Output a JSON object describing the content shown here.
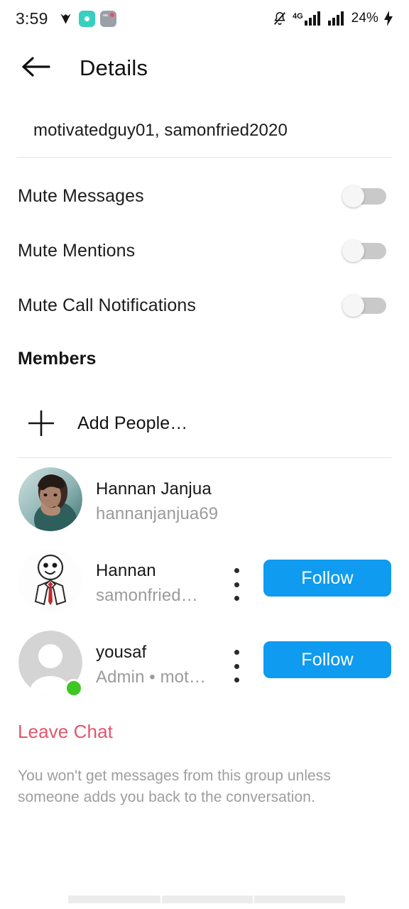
{
  "status_bar": {
    "time": "3:59",
    "app_icons": [
      "dark-logo-icon",
      "teal-app-icon",
      "gray-app-icon"
    ],
    "notification_icon": "bell-muted-icon",
    "network_label": "4G",
    "signal_icon": "signal-bars-icon",
    "battery_percent": "24%",
    "charging_icon": "lightning-bolt-icon"
  },
  "app_bar": {
    "back_icon": "back-arrow-icon",
    "title": "Details"
  },
  "thread": {
    "participants": "motivatedguy01, samonfried2020"
  },
  "settings": [
    {
      "label": "Mute Messages",
      "enabled": false
    },
    {
      "label": "Mute Mentions",
      "enabled": false
    },
    {
      "label": "Mute Call Notifications",
      "enabled": false
    }
  ],
  "members_section": {
    "heading": "Members",
    "add_people_label": "Add People…",
    "add_icon": "plus-icon"
  },
  "members": [
    {
      "name": "Hannan Janjua",
      "subtitle": "hannanjanjua69",
      "avatar_type": "photo-teal",
      "has_menu": false,
      "has_follow": false,
      "online": false
    },
    {
      "name": "Hannan",
      "subtitle": "samonfried…",
      "avatar_type": "stick-figure-red-tie",
      "has_menu": true,
      "menu_icon": "kebab-menu-icon",
      "has_follow": true,
      "follow_label": "Follow",
      "online": false
    },
    {
      "name": "yousaf",
      "subtitle": "Admin • mot…",
      "avatar_type": "default-person",
      "has_menu": true,
      "menu_icon": "kebab-menu-icon",
      "has_follow": true,
      "follow_label": "Follow",
      "online": true
    }
  ],
  "leave": {
    "label": "Leave Chat",
    "note": "You won't get messages from this group unless someone adds you back to the conversation."
  },
  "colors": {
    "follow_blue": "#0e9bf0",
    "leave_red": "#e2566c",
    "online_green": "#3ec724",
    "muted_text": "#9b9b9b"
  }
}
